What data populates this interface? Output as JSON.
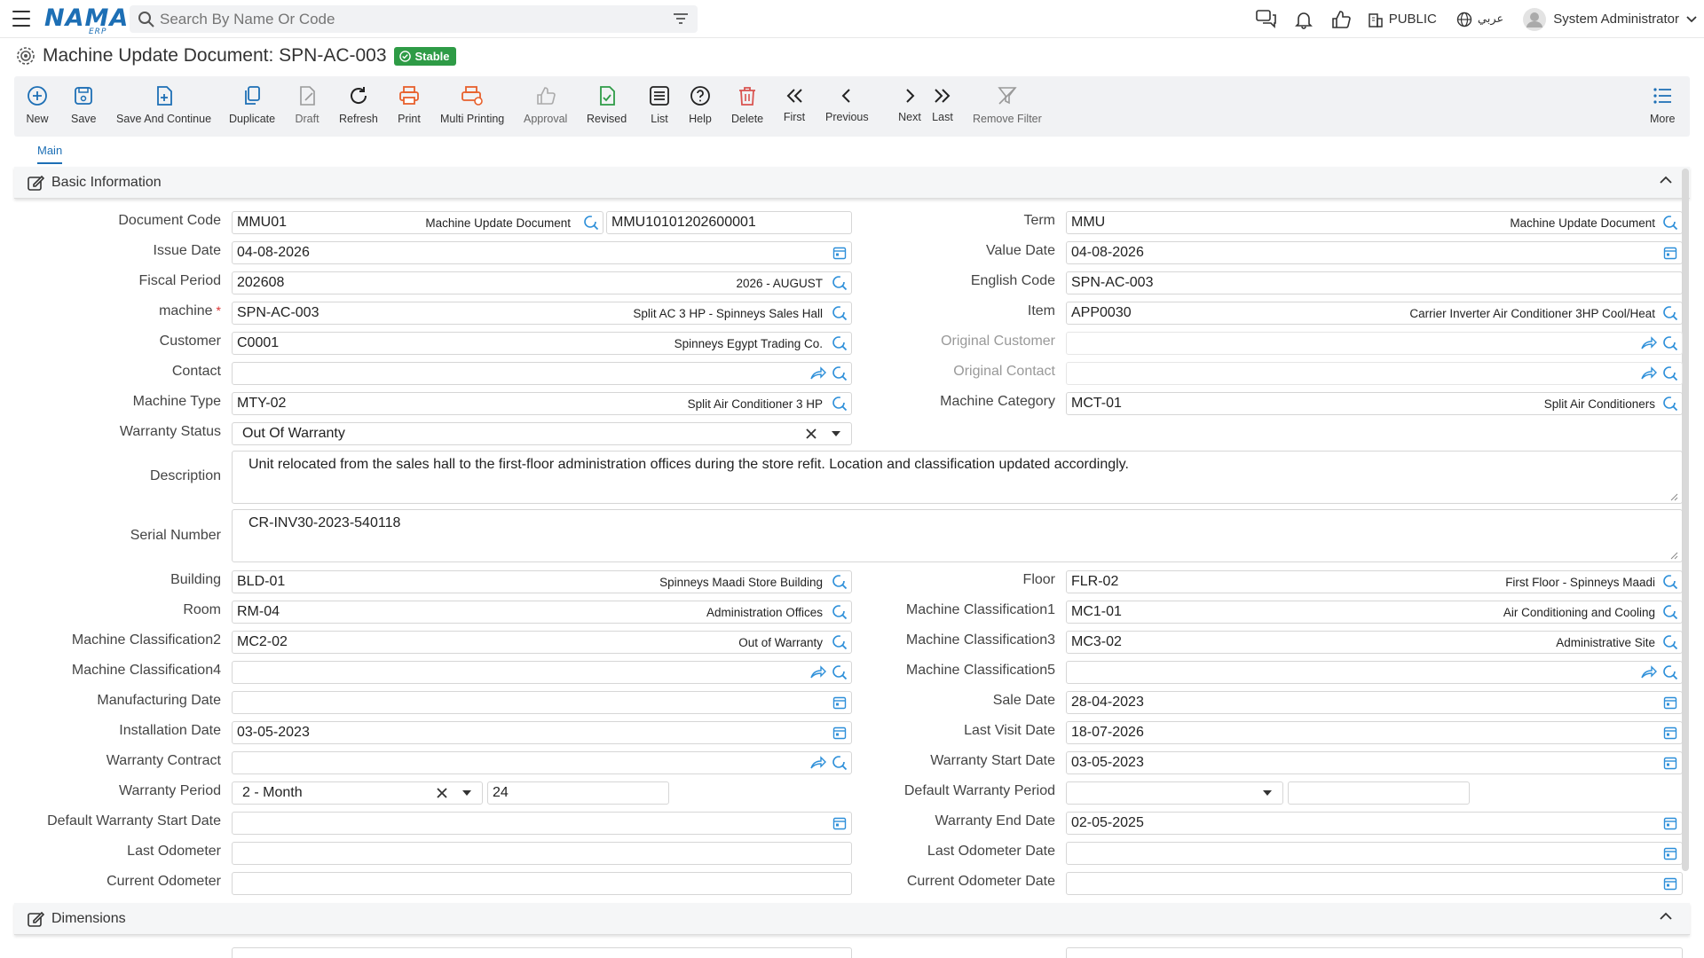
{
  "app": {
    "logo": "NAMA",
    "logo_sub": "ERP"
  },
  "search": {
    "placeholder": "Search By Name Or Code"
  },
  "header": {
    "branch": "PUBLIC",
    "language": "عربي",
    "user": "System Administrator"
  },
  "page": {
    "title": "Machine Update Document: SPN-AC-003",
    "status": "Stable"
  },
  "toolbar": {
    "new": "New",
    "save": "Save",
    "save_continue": "Save And Continue",
    "duplicate": "Duplicate",
    "draft": "Draft",
    "refresh": "Refresh",
    "print": "Print",
    "multi_printing": "Multi Printing",
    "approval": "Approval",
    "revised": "Revised",
    "list": "List",
    "help": "Help",
    "delete": "Delete",
    "first": "First",
    "previous": "Previous",
    "next": "Next",
    "last": "Last",
    "remove_filter": "Remove Filter",
    "more": "More"
  },
  "tabs": {
    "main": "Main"
  },
  "sections": {
    "basic": "Basic Information",
    "dimensions": "Dimensions"
  },
  "form": {
    "document_code": {
      "label": "Document Code",
      "code": "MMU01",
      "desc": "Machine Update Document",
      "number": "MMU10101202600001"
    },
    "term": {
      "label": "Term",
      "code": "MMU",
      "desc": "Machine Update Document"
    },
    "issue_date": {
      "label": "Issue Date",
      "value": "04-08-2026"
    },
    "value_date": {
      "label": "Value Date",
      "value": "04-08-2026"
    },
    "fiscal_period": {
      "label": "Fiscal Period",
      "code": "202608",
      "desc": "2026 - AUGUST"
    },
    "english_code": {
      "label": "English Code",
      "value": "SPN-AC-003"
    },
    "machine": {
      "label": "machine",
      "required": "*",
      "code": "SPN-AC-003",
      "desc": "Split AC 3 HP - Spinneys Sales Hall"
    },
    "item": {
      "label": "Item",
      "code": "APP0030",
      "desc": "Carrier Inverter Air Conditioner 3HP Cool/Heat"
    },
    "customer": {
      "label": "Customer",
      "code": "C0001",
      "desc": "Spinneys Egypt Trading Co."
    },
    "original_customer": {
      "label": "Original Customer"
    },
    "contact": {
      "label": "Contact"
    },
    "original_contact": {
      "label": "Original Contact"
    },
    "machine_type": {
      "label": "Machine Type",
      "code": "MTY-02",
      "desc": "Split Air Conditioner 3 HP"
    },
    "machine_category": {
      "label": "Machine Category",
      "code": "MCT-01",
      "desc": "Split Air Conditioners"
    },
    "warranty_status": {
      "label": "Warranty Status",
      "value": "Out Of Warranty"
    },
    "description": {
      "label": "Description",
      "value": "Unit relocated from the sales hall to the first-floor administration offices during the store refit. Location and classification updated accordingly."
    },
    "serial_number": {
      "label": "Serial Number",
      "value": "CR-INV30-2023-540118"
    },
    "building": {
      "label": "Building",
      "code": "BLD-01",
      "desc": "Spinneys Maadi Store Building"
    },
    "floor": {
      "label": "Floor",
      "code": "FLR-02",
      "desc": "First Floor - Spinneys Maadi"
    },
    "room": {
      "label": "Room",
      "code": "RM-04",
      "desc": "Administration Offices"
    },
    "mc1": {
      "label": "Machine Classification1",
      "code": "MC1-01",
      "desc": "Air Conditioning and Cooling"
    },
    "mc2": {
      "label": "Machine Classification2",
      "code": "MC2-02",
      "desc": "Out of Warranty"
    },
    "mc3": {
      "label": "Machine Classification3",
      "code": "MC3-02",
      "desc": "Administrative Site"
    },
    "mc4": {
      "label": "Machine Classification4"
    },
    "mc5": {
      "label": "Machine Classification5"
    },
    "manufacturing_date": {
      "label": "Manufacturing Date",
      "value": ""
    },
    "sale_date": {
      "label": "Sale Date",
      "value": "28-04-2023"
    },
    "installation_date": {
      "label": "Installation Date",
      "value": "03-05-2023"
    },
    "last_visit_date": {
      "label": "Last Visit Date",
      "value": "18-07-2026"
    },
    "warranty_contract": {
      "label": "Warranty Contract"
    },
    "warranty_start_date": {
      "label": "Warranty Start Date",
      "value": "03-05-2023"
    },
    "warranty_period": {
      "label": "Warranty Period",
      "unit": "2 - Month",
      "value": "24"
    },
    "default_warranty_period": {
      "label": "Default Warranty Period"
    },
    "default_warranty_start_date": {
      "label": "Default Warranty Start Date"
    },
    "warranty_end_date": {
      "label": "Warranty End Date",
      "value": "02-05-2025"
    },
    "last_odometer": {
      "label": "Last Odometer"
    },
    "last_odometer_date": {
      "label": "Last Odometer Date"
    },
    "current_odometer": {
      "label": "Current Odometer"
    },
    "current_odometer_date": {
      "label": "Current Odometer Date"
    }
  },
  "colors": {
    "brand": "#1d6fb5",
    "stable": "#2e9b46",
    "print": "#e8602c",
    "revised": "#2e9b46",
    "delete": "#d9534f"
  }
}
